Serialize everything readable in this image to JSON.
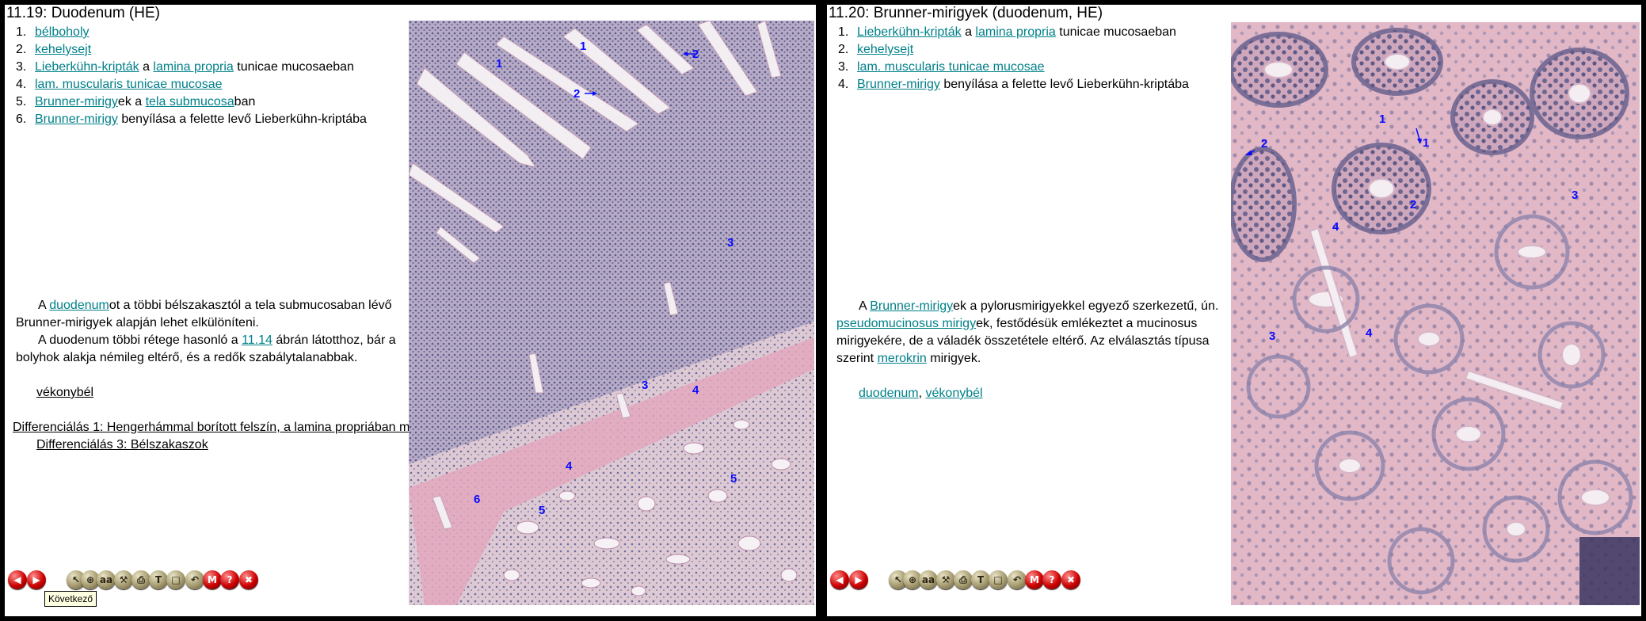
{
  "left": {
    "title": "11.19: Duodenum (HE)",
    "labels": [
      {
        "num": "1.",
        "parts": [
          {
            "t": "bélboholy",
            "link": true
          }
        ]
      },
      {
        "num": "2.",
        "parts": [
          {
            "t": "kehelysejt",
            "link": true
          }
        ]
      },
      {
        "num": "3.",
        "parts": [
          {
            "t": "Lieberkühn-kripták",
            "link": true
          },
          {
            "t": " a ",
            "link": false
          },
          {
            "t": "lamina propria",
            "link": true
          },
          {
            "t": " tunicae mucosaeban",
            "link": false
          }
        ]
      },
      {
        "num": "4.",
        "parts": [
          {
            "t": "lam. muscularis tunicae mucosae",
            "link": true
          }
        ]
      },
      {
        "num": "5.",
        "parts": [
          {
            "t": "Brunner-mirigy",
            "link": true
          },
          {
            "t": "ek a ",
            "link": false
          },
          {
            "t": "tela submucosa",
            "link": true
          },
          {
            "t": "ban",
            "link": false
          }
        ]
      },
      {
        "num": "6.",
        "parts": [
          {
            "t": "Brunner-mirigy",
            "link": true
          },
          {
            "t": " benyílása a felette levő Lieberkühn-kriptába",
            "link": false
          }
        ]
      }
    ],
    "desc1": {
      "a": "A ",
      "link": "duodenum",
      "b": "ot a többi bélszakasztól a tela submucosaban lévő",
      "c": "Brunner-mirigyek alapján lehet elkülöníteni."
    },
    "desc2": {
      "a": "A duodenum többi rétege hasonló a ",
      "link": "11.14",
      "b": " ábrán látotthoz, bár a",
      "c": "bolyhok alakja némileg eltérő, és a redők szabálytalanabbak."
    },
    "related": "vékonybél",
    "diff1": "Differenciálás 1: Hengerhámmal borított felszín, a lamina propriában m",
    "diff3": "Differenciálás 3: Bélszakaszok",
    "image_labels": [
      "1",
      "1",
      "2",
      "2",
      "3",
      "3",
      "4",
      "4",
      "5",
      "5",
      "6"
    ]
  },
  "right": {
    "title": "11.20: Brunner-mirigyek (duodenum, HE)",
    "labels": [
      {
        "num": "1.",
        "parts": [
          {
            "t": "Lieberkühn-kripták",
            "link": true
          },
          {
            "t": " a ",
            "link": false
          },
          {
            "t": "lamina propria",
            "link": true
          },
          {
            "t": " tunicae mucosaeban",
            "link": false
          }
        ]
      },
      {
        "num": "2.",
        "parts": [
          {
            "t": "kehelysejt",
            "link": true
          }
        ]
      },
      {
        "num": "3.",
        "parts": [
          {
            "t": "lam. muscularis tunicae mucosae",
            "link": true
          }
        ]
      },
      {
        "num": "4.",
        "parts": [
          {
            "t": "Brunner-mirigy",
            "link": true
          },
          {
            "t": " benyílása a felette levő Lieberkühn-kriptába",
            "link": false
          }
        ]
      }
    ],
    "desc": {
      "a": "A ",
      "link1": "Brunner-mirigy",
      "b": "ek a pylorusmirigyekkel egyező szerkezetű, ún.",
      "link2": "pseudomucinosus mirigy",
      "c": "ek, festődésük emlékeztet a mucinosus",
      "d": "mirigyekére, de a váladék összetétele eltérő. Az elválasztás típusa",
      "e": "szerint ",
      "link3": "merokrin",
      "f": " mirigyek."
    },
    "related1": "duodenum",
    "related_sep": ", ",
    "related2": "vékonybél",
    "image_labels": [
      "1",
      "1",
      "2",
      "2",
      "3",
      "3",
      "4",
      "4"
    ]
  },
  "toolbar": {
    "buttons": [
      "prev-icon",
      "next-icon",
      "pointer-icon",
      "zoom-icon",
      "text-size-icon",
      "hammer-icon",
      "print-icon",
      "text-icon",
      "page-icon",
      "back-icon",
      "menu-icon",
      "help-icon",
      "exit-icon"
    ],
    "tooltip": "Következő"
  },
  "colors": {
    "link": "#00808a",
    "label": "#0a0aff",
    "background": "#000000",
    "panel": "#ffffff"
  }
}
